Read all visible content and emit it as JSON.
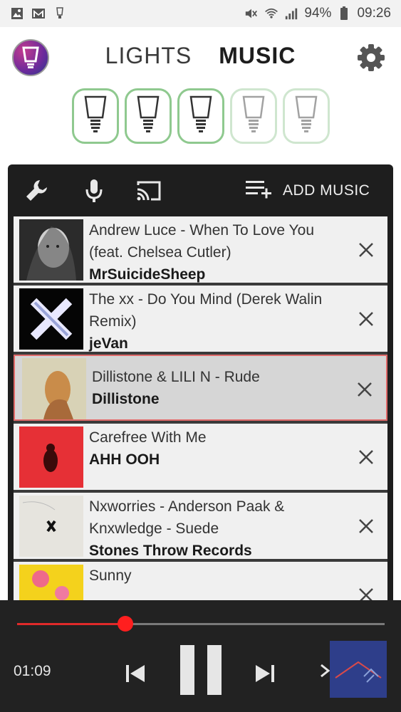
{
  "status_bar": {
    "battery": "94%",
    "time": "09:26"
  },
  "header": {
    "tab_lights": "LIGHTS",
    "tab_music": "MUSIC",
    "settings_icon": "gear-icon",
    "logo_icon": "app-logo-icon"
  },
  "bulbs": [
    {
      "state": "on"
    },
    {
      "state": "on"
    },
    {
      "state": "on"
    },
    {
      "state": "off"
    },
    {
      "state": "off"
    }
  ],
  "toolbar": {
    "add_music_label": "ADD MUSIC"
  },
  "tracks": [
    {
      "title": "Andrew Luce - When To Love You (feat. Chelsea Cutler)",
      "artist": "MrSuicideSheep",
      "selected": false
    },
    {
      "title": "The xx - Do You Mind (Derek Walin Remix)",
      "artist": "jeVan",
      "selected": false
    },
    {
      "title": "Dillistone & LILI N - Rude",
      "artist": "Dillistone",
      "selected": true
    },
    {
      "title": "Carefree With Me",
      "artist": "AHH OOH",
      "selected": false
    },
    {
      "title": "Nxworries - Anderson Paak & Knxwledge - Suede",
      "artist": "Stones Throw Records",
      "selected": false
    },
    {
      "title": "Sunny",
      "artist": "",
      "selected": false
    }
  ],
  "player": {
    "elapsed": "01:09",
    "progress": 0.295
  },
  "colors": {
    "accent_red": "#ff1f1f",
    "bulb_border": "#8fc98f",
    "panel_bg": "#1e1e1e"
  }
}
